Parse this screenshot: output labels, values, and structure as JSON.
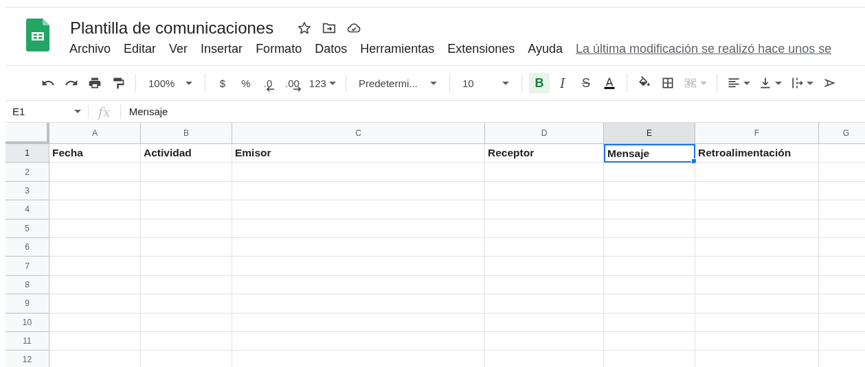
{
  "document": {
    "title": "Plantilla de comunicaciones"
  },
  "menu": [
    "Archivo",
    "Editar",
    "Ver",
    "Insertar",
    "Formato",
    "Datos",
    "Herramientas",
    "Extensiones",
    "Ayuda"
  ],
  "last_edit": "La última modificación se realizó hace unos se",
  "toolbar": {
    "zoom": "100%",
    "currency": "$",
    "percent": "%",
    "decrease_decimals": ".0",
    "increase_decimals": ".00",
    "more_formats": "123",
    "font": "Predetermi...",
    "font_size": "10",
    "bold": {
      "label": "B",
      "selected": true
    },
    "italic": {
      "label": "I",
      "selected": false
    },
    "strikethrough": {
      "label": "S",
      "selected": false
    },
    "merge": {
      "disabled": true
    }
  },
  "formula_bar": {
    "cell_ref": "E1",
    "fx": "fx",
    "value": "Mensaje"
  },
  "sheet": {
    "columns": [
      {
        "label": "A",
        "selected": false
      },
      {
        "label": "B",
        "selected": false
      },
      {
        "label": "C",
        "selected": false
      },
      {
        "label": "D",
        "selected": false
      },
      {
        "label": "E",
        "selected": true
      },
      {
        "label": "F",
        "selected": false
      },
      {
        "label": "G",
        "selected": false
      }
    ],
    "rows": [
      {
        "label": "1",
        "selected": true,
        "cells": [
          {
            "text": "Fecha",
            "selected": false
          },
          {
            "text": "Actividad",
            "selected": false
          },
          {
            "text": "Emisor",
            "selected": false
          },
          {
            "text": "Receptor",
            "selected": false
          },
          {
            "text": "Mensaje",
            "selected": true
          },
          {
            "text": "Retroalimentación",
            "selected": false
          }
        ]
      },
      {
        "label": "2",
        "selected": false
      },
      {
        "label": "3",
        "selected": false
      },
      {
        "label": "4",
        "selected": false
      },
      {
        "label": "5",
        "selected": false
      },
      {
        "label": "6",
        "selected": false
      },
      {
        "label": "7",
        "selected": false
      },
      {
        "label": "8",
        "selected": false
      },
      {
        "label": "9",
        "selected": false
      },
      {
        "label": "10",
        "selected": false
      },
      {
        "label": "11",
        "selected": false
      },
      {
        "label": "12",
        "selected": false
      }
    ]
  }
}
